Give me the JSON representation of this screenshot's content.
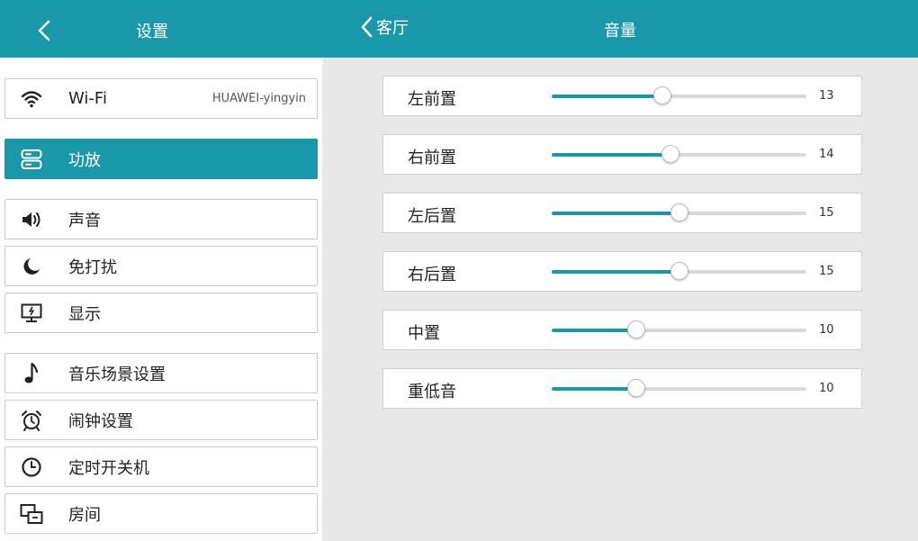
{
  "left_panel": {
    "title": "设置",
    "items": [
      {
        "label": "Wi-Fi",
        "value": "HUAWEI-yingyin",
        "icon": "wifi-icon"
      },
      {
        "label": "功放",
        "icon": "amplifier-icon",
        "active": true
      },
      {
        "label": "声音",
        "icon": "speaker-icon"
      },
      {
        "label": "免打扰",
        "icon": "moon-icon"
      },
      {
        "label": "显示",
        "icon": "monitor-icon"
      },
      {
        "label": "音乐场景设置",
        "icon": "music-note-icon"
      },
      {
        "label": "闹钟设置",
        "icon": "alarm-clock-icon"
      },
      {
        "label": "定时开关机",
        "icon": "clock-icon"
      },
      {
        "label": "房间",
        "icon": "rooms-icon"
      }
    ]
  },
  "right_panel": {
    "back_label": "客厅",
    "title": "音量",
    "slider_max": 30,
    "channels": [
      {
        "label": "左前置",
        "value": 13
      },
      {
        "label": "右前置",
        "value": 14
      },
      {
        "label": "左后置",
        "value": 15
      },
      {
        "label": "右后置",
        "value": 15
      },
      {
        "label": "中置",
        "value": 10
      },
      {
        "label": "重低音",
        "value": 10
      }
    ]
  },
  "colors": {
    "accent": "#1a97a8",
    "background": "#e8e8e8",
    "track": "#d9d9d9"
  }
}
